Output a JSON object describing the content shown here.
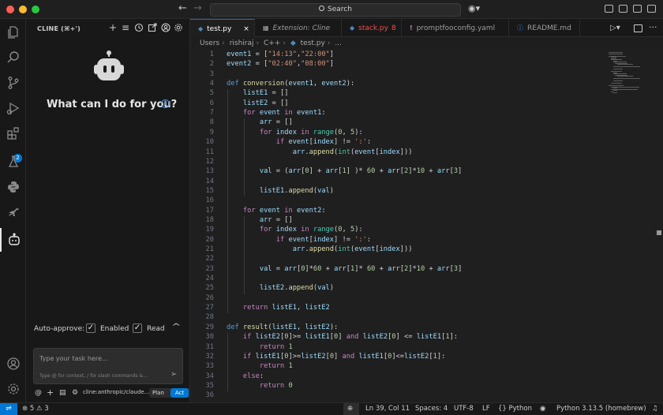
{
  "titlebar": {
    "search_label": "Search",
    "colors": {
      "close": "#ff5f57",
      "minimize": "#febc2e",
      "maximize": "#28c840"
    }
  },
  "activity_bar": {
    "items": [
      "explorer-icon",
      "search-icon",
      "source-control-icon",
      "run-debug-icon",
      "extensions-icon",
      "testing-icon",
      "python-icon",
      "kangaroo-icon",
      "cline-icon"
    ],
    "extensions_badge": "2",
    "bottom": [
      "account-icon",
      "settings-gear-icon"
    ]
  },
  "cline": {
    "title": "CLINE (⌘+')",
    "hero": "What can I do for you?",
    "auto_approve_label": "Auto-approve:",
    "enabled_label": "Enabled",
    "read_label": "Read",
    "task_placeholder": "Type your task here...",
    "task_hint": "Type @ for context, / for slash commands &...",
    "model": "cline:anthropic/claude...",
    "plan_label": "Plan",
    "act_label": "Act"
  },
  "tabs": [
    {
      "label": "test.py",
      "icon": "python-file-icon",
      "active": true
    },
    {
      "label": "Extension: Cline",
      "icon": "extension-file-icon",
      "italic": true
    },
    {
      "label": "stack.py",
      "icon": "python-file-icon",
      "problems": "8",
      "error": true
    },
    {
      "label": "promptfooconfig.yaml",
      "icon": "yaml-file-icon"
    },
    {
      "label": "README.md",
      "icon": "info-file-icon"
    }
  ],
  "breadcrumb": [
    "Users",
    "rishiraj",
    "C++",
    "test.py",
    "..."
  ],
  "code": {
    "current_line": 39,
    "lines": [
      "event1 = [\"14:13\",\"22:00\"]",
      "event2 = [\"02:40\",\"08:00\"]",
      "",
      "def conversion(event1, event2):",
      "    listE1 = []",
      "    listE2 = []",
      "    for event in event1:",
      "        arr = []",
      "        for index in range(0, 5):",
      "            if event[index] != ':':",
      "                arr.append(int(event[index]))",
      "",
      "        val = (arr[0] + arr[1] )* 60 + arr[2]*10 + arr[3]",
      "",
      "        listE1.append(val)",
      "",
      "    for event in event2:",
      "        arr = []",
      "        for index in range(0, 5):",
      "            if event[index] != ':':",
      "                arr.append(int(event[index]))",
      "",
      "        val = arr[0]*60 + arr[1]* 60 + arr[2]*10 + arr[3]",
      "",
      "        listE2.append(val)",
      "",
      "    return listE1, listE2",
      "",
      "def result(listE1, listE2):",
      "    if listE2[0]>= listE1[0] and listE2[0] <= listE1[1]:",
      "        return 1",
      "    if listE1[0]>=listE2[0] and listE1[0]<=listE2[1]:",
      "        return 1",
      "    else:",
      "        return 0",
      ""
    ]
  },
  "status": {
    "errors": "5",
    "warnings": "3",
    "position": "Ln 39, Col 11",
    "spaces": "Spaces: 4",
    "encoding": "UTF-8",
    "eol": "LF",
    "language": "Python",
    "interpreter": "Python 3.13.5 (homebrew)"
  }
}
